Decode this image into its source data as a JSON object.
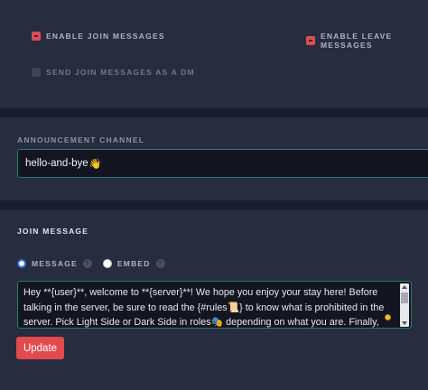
{
  "toggles": {
    "enable_join": {
      "label": "ENABLE JOIN MESSAGES",
      "checked": true
    },
    "enable_leave": {
      "label": "ENABLE LEAVE MESSAGES",
      "checked": true
    },
    "send_as_dm": {
      "label": "SEND JOIN MESSAGES AS A DM",
      "checked": false
    }
  },
  "channel": {
    "label": "ANNOUNCEMENT CHANNEL",
    "value": "hello-and-bye",
    "emoji": "👋"
  },
  "join_message": {
    "heading": "JOIN MESSAGE",
    "options": [
      {
        "label": "MESSAGE",
        "selected": true
      },
      {
        "label": "EMBED",
        "selected": false
      }
    ],
    "help_glyph": "?",
    "text": "Hey **{user}**, welcome to **{server}**! We hope you enjoy your stay here! Before talking in the server, be sure to read the {#rules📜} to know what is prohibited in the server. Pick Light Side or Dark Side in roles🎭 depending on what you are. Finally, make sure to"
  },
  "update_button": {
    "label": "Update"
  },
  "colors": {
    "accent_red": "#e24a4d",
    "focus_border": "#2c7a67",
    "panel_bg": "#272c3f",
    "page_bg": "#1a1d2b"
  }
}
